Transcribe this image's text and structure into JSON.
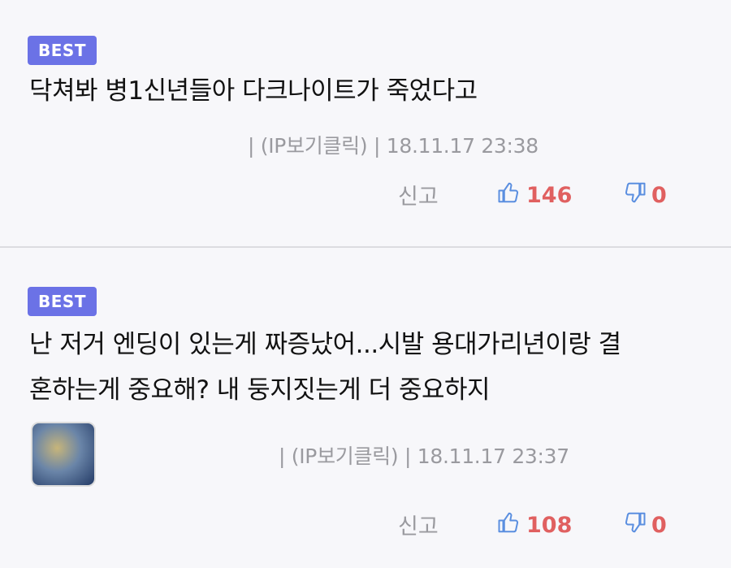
{
  "comments": [
    {
      "badge": "BEST",
      "text": "닥쳐봐 병1신년들아 다크나이트가 죽었다고",
      "meta": "| (IP보기클릭) | 18.11.17 23:38",
      "report": "신고",
      "likes": "146",
      "dislikes": "0"
    },
    {
      "badge": "BEST",
      "text_line1": "난 저거 엔딩이 있는게 짜증났어...시발 용대가리년이랑 결",
      "text_line2": "혼하는게 중요해? 내 둥지짓는게 더 중요하지",
      "meta": "| (IP보기클릭) | 18.11.17 23:37",
      "report": "신고",
      "likes": "108",
      "dislikes": "0"
    }
  ],
  "colors": {
    "badge": "#6b72e6",
    "thumb": "#5b8fe0",
    "count": "#e06060",
    "meta": "#9a9a9f"
  },
  "icons": {
    "like": "thumbs-up-icon",
    "dislike": "thumbs-down-icon"
  }
}
